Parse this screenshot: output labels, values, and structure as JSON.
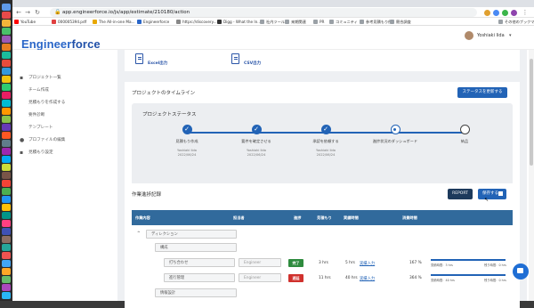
{
  "browser": {
    "url": "app.engineerforce.io/js/app/estimate/210180/action",
    "bookmarks": [
      {
        "label": "YouTube",
        "color": "#ff0000"
      },
      {
        "label": "000005394.pdf",
        "color": "#e04040"
      },
      {
        "label": "The All-in-one Ma...",
        "color": "#e8a800"
      },
      {
        "label": "Engineerforce",
        "color": "#2a66c8"
      },
      {
        "label": "https://discovery...",
        "color": "#888888"
      },
      {
        "label": "Digg - What the In...",
        "color": "#333333"
      },
      {
        "label": "社内ツール",
        "color": "#9aa0a6"
      },
      {
        "label": "来期関連",
        "color": "#9aa0a6"
      },
      {
        "label": "PR",
        "color": "#9aa0a6"
      },
      {
        "label": "コミュニティ",
        "color": "#9aa0a6"
      },
      {
        "label": "参考見積もり例",
        "color": "#9aa0a6"
      },
      {
        "label": "競合調査",
        "color": "#9aa0a6"
      },
      {
        "label": "その他のブックマーク",
        "color": "#9aa0a6"
      }
    ]
  },
  "app": {
    "logo_a": "Engineer",
    "logo_b": "force",
    "user_name": "Yoshiaki Iida"
  },
  "sidebar": {
    "items": [
      {
        "label": "プロジェクト一覧",
        "icon": "folder-icon"
      },
      {
        "label": "チーム作成",
        "icon": ""
      },
      {
        "label": "見積もりを作成する",
        "icon": ""
      },
      {
        "label": "要件診断",
        "icon": ""
      },
      {
        "label": "テンプレート",
        "icon": ""
      },
      {
        "label": "プロファイルの編集",
        "icon": "person-icon"
      },
      {
        "label": "見積もり設定",
        "icon": "book-icon"
      }
    ]
  },
  "export": {
    "excel": "Excel出力",
    "csv": "CSV出力"
  },
  "timeline": {
    "title": "プロジェクトのタイムライン",
    "update_button": "ステータスを更新する",
    "status_title": "プロジェクトステータス",
    "steps": [
      {
        "label": "見積もり作成",
        "by": "Yoshiaki Iida",
        "date": "2022/06/24",
        "state": "done"
      },
      {
        "label": "要件を確定させる",
        "by": "Yoshiaki Iida",
        "date": "2022/06/24",
        "state": "done"
      },
      {
        "label": "承認を依頼する",
        "by": "Yoshiaki Iida",
        "date": "2022/06/24",
        "state": "done"
      },
      {
        "label": "進捗状況のダッシュボード",
        "by": "",
        "date": "",
        "state": "current"
      },
      {
        "label": "納品",
        "by": "",
        "date": "",
        "state": "todo"
      }
    ]
  },
  "worklog": {
    "title": "作業進捗記録",
    "report_button": "REPORT",
    "save_button": "保存する",
    "columns": [
      "作業内容",
      "担当者",
      "進捗",
      "見積もり",
      "実績時間",
      "",
      "消費時間"
    ],
    "group": "ディレクション",
    "subgroup": "構成",
    "rows": [
      {
        "task": "打ち合わせ",
        "assignee_placeholder": "Engineer",
        "status": "完了",
        "estimate": "3 hrs",
        "actual": "5 hrs",
        "action": "実績入力",
        "percent": "167 %",
        "sub_left": "見積時間：3 hrs",
        "sub_right": "残り時間：0 hrs",
        "status_color": "#2e8b3e"
      },
      {
        "task": "進行管理",
        "assignee_placeholder": "Engineer",
        "status": "遅延",
        "estimate": "11 hrs",
        "actual": "40 hrs",
        "action": "実績入力",
        "percent": "364 %",
        "sub_left": "見積時間：40 hrs",
        "sub_right": "残り時間：0 hrs",
        "status_color": "#d0312d"
      }
    ],
    "next_subgroup": "情報設計"
  }
}
